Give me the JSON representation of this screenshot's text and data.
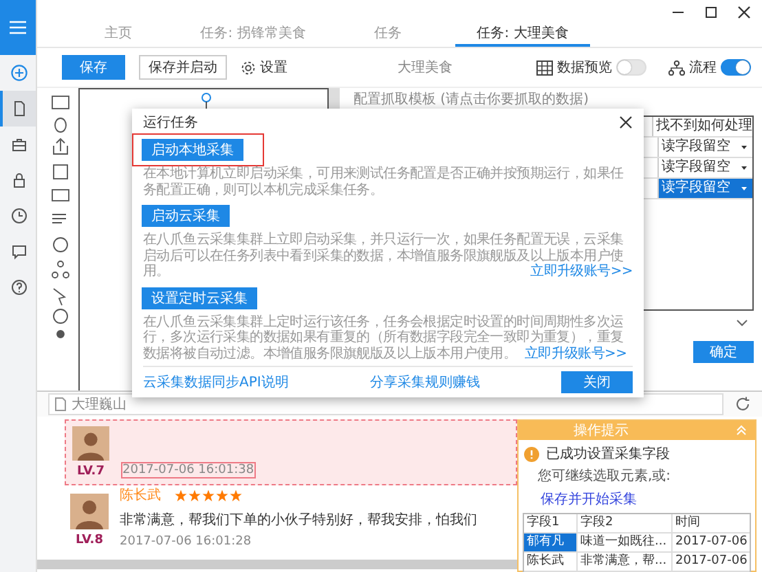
{
  "tabs": [
    {
      "label": "主页",
      "selected": false
    },
    {
      "label": "任务: 拐锋常美食",
      "selected": false
    },
    {
      "label": "任务",
      "selected": false
    },
    {
      "label": "任务: 大理美食",
      "selected": true
    }
  ],
  "sidebar": {
    "items": [
      {
        "kind": "add",
        "selected": false
      },
      {
        "kind": "file",
        "selected": true
      },
      {
        "kind": "briefcase",
        "selected": false
      },
      {
        "kind": "lock",
        "selected": false
      },
      {
        "kind": "clock",
        "selected": false
      },
      {
        "kind": "message",
        "selected": false
      },
      {
        "kind": "help",
        "selected": false
      }
    ]
  },
  "toolbar": {
    "save": "保存",
    "save_and_start": "保存并启动",
    "settings": "设置",
    "task_name": "大理美食",
    "toggles": [
      {
        "kind": "table",
        "label": "数据预览",
        "on": false
      },
      {
        "kind": "flow",
        "label": "流程",
        "on": true
      }
    ]
  },
  "config": {
    "title": "配置抓取模板 (请点击你要抓取的数据)",
    "column": "找不到如何处理",
    "rows": [
      {
        "value": "读字段留空",
        "selected": false
      },
      {
        "value": "读字段留空",
        "selected": false
      },
      {
        "value": "读字段留空",
        "selected": true
      }
    ],
    "confirm_button": "确定"
  },
  "url_field": {
    "value": "大理巍山"
  },
  "reviews": [
    {
      "level": "LV.7",
      "date": "2017-07-06 16:01:38",
      "highlighted": true
    },
    {
      "name": "陈长武",
      "stars": 5,
      "text": "非常满意，帮我们下单的小伙子特别好，帮我安排，怕我们",
      "level": "LV.8",
      "date": "2017-07-06 16:01:28",
      "highlighted": false
    }
  ],
  "tips": {
    "title": "操作提示",
    "message": "已成功设置采集字段",
    "hint": "您可继续选取元素,或:",
    "action": "保存并开始采集",
    "columns": [
      "字段1",
      "字段2",
      "时间"
    ],
    "rows": [
      {
        "cells": [
          "郁有凡",
          "味道一如既往...",
          "2017-07-06"
        ],
        "selected": true
      },
      {
        "cells": [
          "陈长武",
          "非常满意，帮...",
          "2017-07-06"
        ],
        "selected": false
      }
    ]
  },
  "modal": {
    "title": "运行任务",
    "sections": [
      {
        "button": "启动本地采集",
        "highlighted": true,
        "description": "在本地计算机立即启动采集，可用来测试任务配置是否正确并按预期运行，如果任务配置正确，则可以本机完成采集任务。"
      },
      {
        "button": "启动云采集",
        "highlighted": false,
        "description": "在八爪鱼云采集集群上立即启动采集，并只运行一次，如果任务配置无误，云采集启动后可以在任务列表中看到采集的数据，本增值服务限旗舰版及以上版本用户使用。",
        "link": "立即升级账号>>",
        "kind": "float"
      },
      {
        "button": "设置定时云采集",
        "highlighted": false,
        "description": "在八爪鱼云采集集群上定时运行该任务，任务会根据定时设置的时间周期性多次运行，多次运行采集的数据如果有重复的（所有数据字段完全一致即为重复），重复数据将被自动过滤。本增值服务限旗舰版及以上版本用户使用。",
        "link": "立即升级账号>>",
        "kind": "inline"
      }
    ],
    "footer_links": [
      "云采集数据同步API说明",
      "分享采集规则赚钱"
    ],
    "close_button": "关闭"
  }
}
